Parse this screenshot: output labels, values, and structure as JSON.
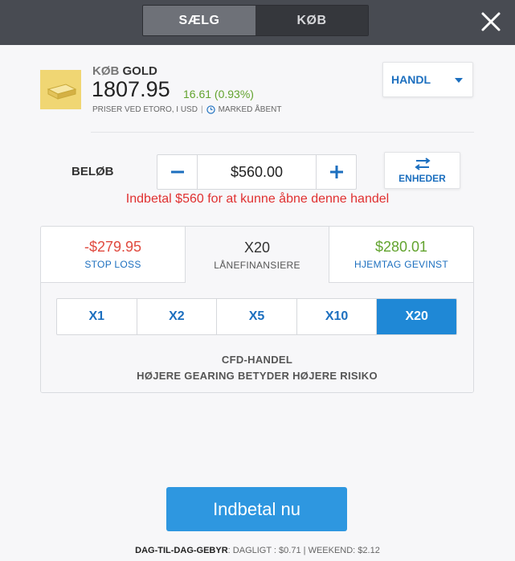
{
  "header": {
    "sell_label": "SÆLG",
    "buy_label": "KØB",
    "active_side": "sell"
  },
  "instrument": {
    "action": "KØB",
    "symbol": "GOLD",
    "price": "1807.95",
    "change": "16.61 (0.93%)",
    "price_note": "PRISER VED ETORO, I USD",
    "separator": "|",
    "market_status": "MARKED ÅBENT",
    "logo_icon": "gold-bar-icon"
  },
  "order_type": {
    "label": "HANDL"
  },
  "amount": {
    "label": "BELØB",
    "value": "$560.00",
    "units_label": "ENHEDER",
    "warning": "Indbetal $560 for at kunne åbne denne handel"
  },
  "panel": {
    "stop_loss": {
      "value": "-$279.95",
      "label": "STOP LOSS"
    },
    "leverage_tab": {
      "value": "X20",
      "label": "LÅNEFINANSIERE"
    },
    "take_profit": {
      "value": "$280.01",
      "label": "HJEMTAG GEVINST"
    },
    "leverage_options": [
      "X1",
      "X2",
      "X5",
      "X10",
      "X20"
    ],
    "selected_leverage": "X20",
    "cfd_line1": "CFD-HANDEL",
    "cfd_line2": "HØJERE GEARING BETYDER HØJERE RISIKO"
  },
  "cta": {
    "label": "Indbetal nu"
  },
  "fees": {
    "title": "DAG-TIL-DAG-GEBYR",
    "daily_label": ": DAGLIGT : ",
    "daily_value": "$0.71",
    "separator": " | ",
    "weekend_label": "WEEKEND: ",
    "weekend_value": "$2.12"
  },
  "colors": {
    "header_bg": "#484b52",
    "accent_blue": "#1c6fbf",
    "cta_blue": "#2e97e0",
    "active_leverage": "#1f88d6",
    "loss_red": "#e04a3f",
    "gain_green": "#62a32e",
    "warning_red": "#e03030",
    "logo_gold": "#f0d673"
  }
}
